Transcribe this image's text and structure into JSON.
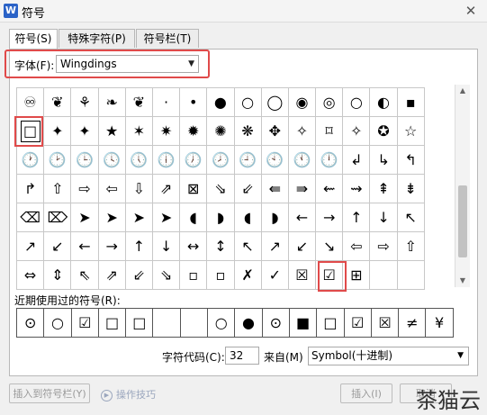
{
  "window": {
    "title": "符号",
    "app_icon": "W",
    "close": "✕"
  },
  "tabs": [
    {
      "label": "符号(S)"
    },
    {
      "label": "特殊字符(P)"
    },
    {
      "label": "符号栏(T)"
    }
  ],
  "font": {
    "label": "字体(F):",
    "value": "Wingdings",
    "arrow": "▼"
  },
  "symbols": [
    [
      "♾",
      "❦",
      "⚘",
      "❧",
      "❦",
      "·",
      "•",
      "●",
      "○",
      "◯",
      "◉",
      "◎",
      "○",
      "◐",
      "▪"
    ],
    [
      "□",
      "✦",
      "✦",
      "★",
      "✶",
      "✷",
      "✹",
      "✺",
      "❋",
      "✥",
      "✧",
      "⌑",
      "✧",
      "✪",
      "☆"
    ],
    [
      "🕐",
      "🕑",
      "🕒",
      "🕓",
      "🕔",
      "🕕",
      "🕖",
      "🕗",
      "🕘",
      "🕙",
      "🕚",
      "🕛",
      "↲",
      "↳",
      "↰"
    ],
    [
      "↱",
      "⇧",
      "⇨",
      "⇦",
      "⇩",
      "⇗",
      "⊠",
      "⇘",
      "⇙",
      "⇚",
      "⇛",
      "⇜",
      "⇝",
      "⇞",
      "⇟"
    ],
    [
      "⌫",
      "⌦",
      "➤",
      "➤",
      "➤",
      "➤",
      "◖",
      "◗",
      "◖",
      "◗",
      "←",
      "→",
      "↑",
      "↓",
      "↖"
    ],
    [
      "↗",
      "↙",
      "←",
      "→",
      "↑",
      "↓",
      "↔",
      "↕",
      "↖",
      "↗",
      "↙",
      "↘",
      "⇦",
      "⇨",
      "⇧"
    ],
    [
      "⇔",
      "⇕",
      "⇖",
      "⇗",
      "⇙",
      "⇘",
      "▫",
      "▫",
      "✗",
      "✓",
      "☒",
      "☑",
      "⊞",
      "",
      ""
    ]
  ],
  "recent": {
    "label": "近期使用过的符号(R):",
    "symbols": [
      "⊙",
      "○",
      "☑",
      "□",
      "□",
      "",
      "",
      "○",
      "●",
      "⊙",
      "■",
      "□",
      "☑",
      "☒",
      "≠",
      "¥"
    ]
  },
  "code": {
    "label": "字符代码(C):",
    "value": "32"
  },
  "from": {
    "label": "来自(M)",
    "value": "Symbol(十进制)",
    "arrow": "▼"
  },
  "buttons": {
    "insert_to_bar": "插入到符号栏(Y)",
    "tips": "操作技巧",
    "insert": "插入(I)",
    "cancel": "取消"
  },
  "watermark": "茶猫云",
  "colors": {
    "highlight": "#e04a4a"
  }
}
